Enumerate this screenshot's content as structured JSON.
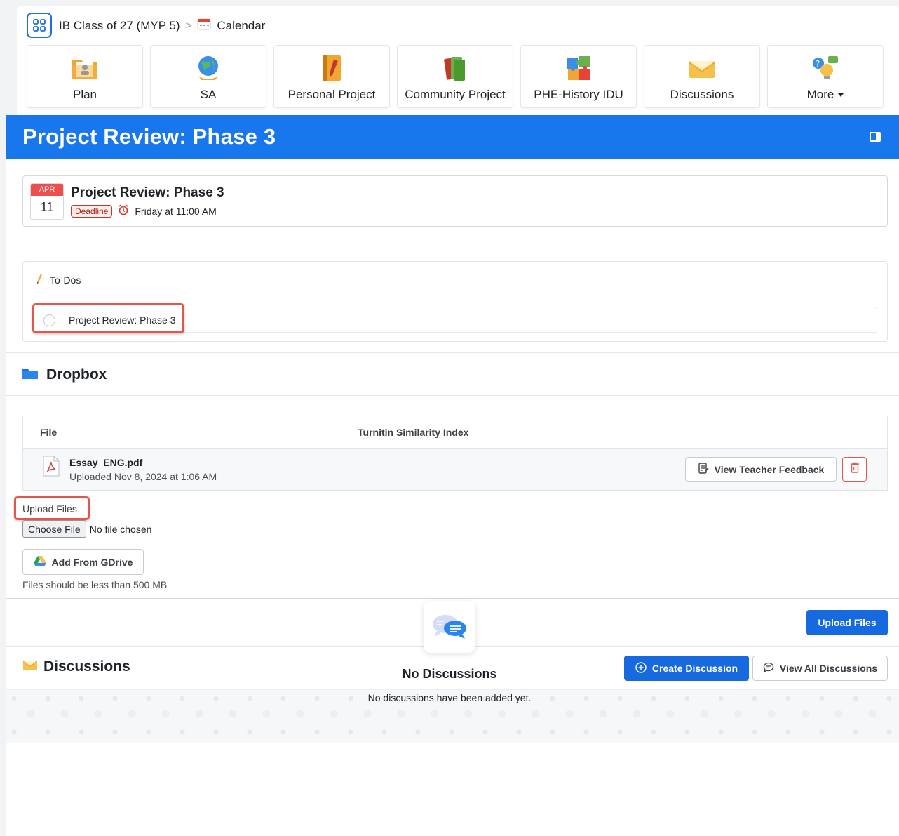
{
  "breadcrumb": {
    "class_name": "IB Class of 27 (MYP 5)",
    "separator": ">",
    "current": "Calendar"
  },
  "nav_tiles": [
    {
      "label": "Plan",
      "icon": "plan-folder-icon"
    },
    {
      "label": "SA",
      "icon": "globe-icon"
    },
    {
      "label": "Personal Project",
      "icon": "notebook-icon"
    },
    {
      "label": "Community Project",
      "icon": "books-icon"
    },
    {
      "label": "PHE-History IDU",
      "icon": "puzzle-icon"
    },
    {
      "label": "Discussions",
      "icon": "envelope-icon"
    },
    {
      "label": "More",
      "icon": "ideas-icon"
    }
  ],
  "page": {
    "title": "Project Review: Phase 3"
  },
  "event": {
    "month": "APR",
    "day": "11",
    "title": "Project Review: Phase 3",
    "badge": "Deadline",
    "time": "Friday at 11:00 AM"
  },
  "todos": {
    "header": "To-Dos",
    "items": [
      {
        "label": "Project Review: Phase 3",
        "checked": false
      }
    ]
  },
  "dropbox": {
    "title": "Dropbox",
    "columns": [
      "File",
      "Turnitin Similarity Index"
    ],
    "files": [
      {
        "name": "Essay_ENG.pdf",
        "uploaded": "Uploaded Nov 8, 2024 at 1:06 AM"
      }
    ],
    "feedback_label": "View Teacher Feedback",
    "upload_label": "Upload Files",
    "choose_file_label": "Choose File",
    "no_file_text": "No file chosen",
    "gdrive_label": "Add From GDrive",
    "size_hint": "Files should be less than 500 MB",
    "upload_button": "Upload Files"
  },
  "discussions": {
    "title": "Discussions",
    "create_label": "Create Discussion",
    "view_all_label": "View All Discussions",
    "empty_title": "No Discussions",
    "empty_text": "No discussions have been added yet."
  },
  "colors": {
    "brand_blue": "#1877ec",
    "button_blue": "#1769e0",
    "danger_red": "#e05a55",
    "highlight_red": "#e4564b"
  }
}
